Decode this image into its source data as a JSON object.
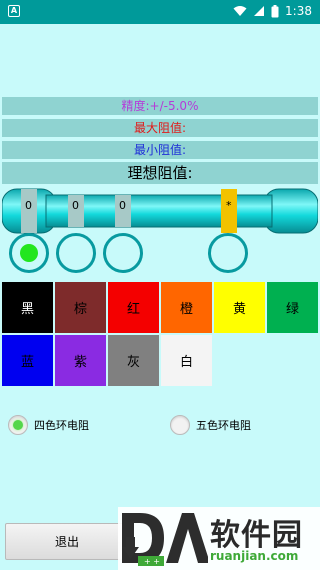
{
  "status_bar": {
    "time": "1:38",
    "notification_icon": "app-notification-icon"
  },
  "info": {
    "precision": "精度:+/-5.0%",
    "max_resistance": "最大阻值:",
    "min_resistance": "最小阻值:",
    "ideal_resistance": "理想阻值:"
  },
  "resistor": {
    "bands": [
      {
        "label": "0",
        "color": "#a7c9c7"
      },
      {
        "label": "0",
        "color": "#a7c9c7"
      },
      {
        "label": "0",
        "color": "#a7c9c7"
      },
      {
        "label": "*",
        "color": "#f2c200"
      }
    ],
    "body_color": "#15d8dc"
  },
  "selectors": {
    "active_index": 0
  },
  "colors": [
    {
      "label": "黑",
      "bg": "#000000"
    },
    {
      "label": "棕",
      "bg": "#7e2b2b"
    },
    {
      "label": "红",
      "bg": "#f40000"
    },
    {
      "label": "橙",
      "bg": "#ff6600"
    },
    {
      "label": "黄",
      "bg": "#ffff00"
    },
    {
      "label": "绿",
      "bg": "#00b050"
    },
    {
      "label": "蓝",
      "bg": "#0000f0"
    },
    {
      "label": "紫",
      "bg": "#8a2be2"
    },
    {
      "label": "灰",
      "bg": "#808080"
    },
    {
      "label": "白",
      "bg": "#f4f4f4"
    }
  ],
  "ring_mode": {
    "options": [
      {
        "label": "四色环电阻",
        "selected": true
      },
      {
        "label": "五色环电阻",
        "selected": false
      }
    ]
  },
  "buttons": {
    "exit": "退出"
  },
  "watermark": {
    "logo_text": "DA",
    "brand": "软件园",
    "url": "ruanjian.com"
  }
}
